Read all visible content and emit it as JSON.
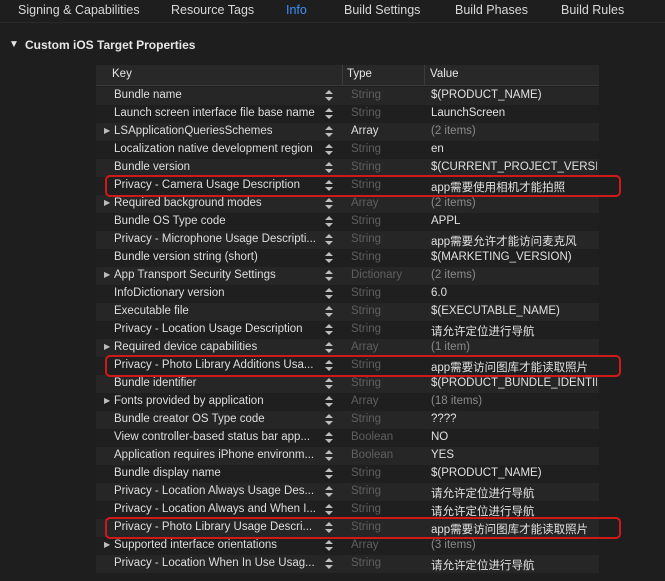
{
  "tabs": [
    {
      "label": "Signing & Capabilities",
      "active": false
    },
    {
      "label": "Resource Tags",
      "active": false
    },
    {
      "label": "Info",
      "active": true
    },
    {
      "label": "Build Settings",
      "active": false
    },
    {
      "label": "Build Phases",
      "active": false
    },
    {
      "label": "Build Rules",
      "active": false
    }
  ],
  "section": {
    "title": "Custom iOS Target Properties"
  },
  "columns": {
    "key": "Key",
    "type": "Type",
    "value": "Value"
  },
  "rows": [
    {
      "key": "Bundle name",
      "type": "String",
      "value": "$(PRODUCT_NAME)",
      "expandable": false
    },
    {
      "key": "Launch screen interface file base name",
      "type": "String",
      "value": "LaunchScreen",
      "expandable": false
    },
    {
      "key": "LSApplicationQueriesSchemes",
      "type": "Array",
      "value": "(2 items)",
      "expandable": true
    },
    {
      "key": "Localization native development region",
      "type": "String",
      "value": "en",
      "expandable": false
    },
    {
      "key": "Bundle version",
      "type": "String",
      "value": "$(CURRENT_PROJECT_VERSION)",
      "expandable": false
    },
    {
      "key": "Privacy - Camera Usage Description",
      "type": "String",
      "value": "app需要使用相机才能拍照",
      "expandable": false
    },
    {
      "key": "Required background modes",
      "type": "Array",
      "value": "(2 items)",
      "expandable": true
    },
    {
      "key": "Bundle OS Type code",
      "type": "String",
      "value": "APPL",
      "expandable": false
    },
    {
      "key": "Privacy - Microphone Usage Descripti...",
      "type": "String",
      "value": "app需要允许才能访问麦克风",
      "expandable": false
    },
    {
      "key": "Bundle version string (short)",
      "type": "String",
      "value": "$(MARKETING_VERSION)",
      "expandable": false
    },
    {
      "key": "App Transport Security Settings",
      "type": "Dictionary",
      "value": "(2 items)",
      "expandable": true
    },
    {
      "key": "InfoDictionary version",
      "type": "String",
      "value": "6.0",
      "expandable": false
    },
    {
      "key": "Executable file",
      "type": "String",
      "value": "$(EXECUTABLE_NAME)",
      "expandable": false
    },
    {
      "key": "Privacy - Location Usage Description",
      "type": "String",
      "value": "请允许定位进行导航",
      "expandable": false
    },
    {
      "key": "Required device capabilities",
      "type": "Array",
      "value": "(1 item)",
      "expandable": true
    },
    {
      "key": "Privacy - Photo Library Additions Usa...",
      "type": "String",
      "value": "app需要访问图库才能读取照片",
      "expandable": false
    },
    {
      "key": "Bundle identifier",
      "type": "String",
      "value": "$(PRODUCT_BUNDLE_IDENTIFIER)",
      "expandable": false
    },
    {
      "key": "Fonts provided by application",
      "type": "Array",
      "value": "(18 items)",
      "expandable": true
    },
    {
      "key": "Bundle creator OS Type code",
      "type": "String",
      "value": "????",
      "expandable": false
    },
    {
      "key": "View controller-based status bar app...",
      "type": "Boolean",
      "value": "NO",
      "expandable": false
    },
    {
      "key": "Application requires iPhone environm...",
      "type": "Boolean",
      "value": "YES",
      "expandable": false
    },
    {
      "key": "Bundle display name",
      "type": "String",
      "value": "$(PRODUCT_NAME)",
      "expandable": false
    },
    {
      "key": "Privacy - Location Always Usage Des...",
      "type": "String",
      "value": "请允许定位进行导航",
      "expandable": false
    },
    {
      "key": "Privacy - Location Always and When I...",
      "type": "String",
      "value": "请允许定位进行导航",
      "expandable": false
    },
    {
      "key": "Privacy - Photo Library Usage Descri...",
      "type": "String",
      "value": "app需要访问图库才能读取照片",
      "expandable": false
    },
    {
      "key": "Supported interface orientations",
      "type": "Array",
      "value": "(3 items)",
      "expandable": true
    },
    {
      "key": "Privacy - Location When In Use Usag...",
      "type": "String",
      "value": "请允许定位进行导航",
      "expandable": false
    }
  ],
  "highlighted_rows": [
    5,
    15,
    24
  ],
  "colors": {
    "highlight": "#d01a1a",
    "accent": "#3d8ff5"
  }
}
